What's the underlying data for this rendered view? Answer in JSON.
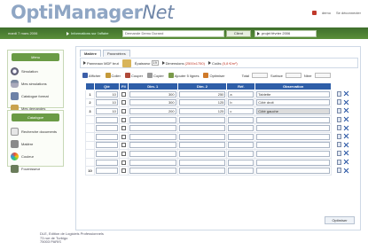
{
  "header": {
    "logo_main": "OptiManager",
    "logo_suffix": "Net",
    "user_name": "demo",
    "logout_label": "Se déconnecter"
  },
  "navbar": {
    "date": "mardi 7 mars 2006",
    "info_link": "Informations sur l'affaire",
    "request_value": "Demande Demo Durand",
    "client_button": "Client",
    "project": "projet février 2006"
  },
  "sidebar": {
    "menu_title": "Menu",
    "menu_items": [
      {
        "label": "Simulation",
        "icon": "clock-icon"
      },
      {
        "label": "Mes simulations",
        "icon": "person-icon"
      },
      {
        "label": "Catalogue format",
        "icon": "catalog-icon"
      },
      {
        "label": "Mes demandes",
        "icon": "folder-icon"
      }
    ],
    "catalog_title": "Catalogue",
    "catalog_items": [
      {
        "label": "Recherche documents",
        "icon": "search-icon"
      },
      {
        "label": "Matière",
        "icon": "material-icon"
      },
      {
        "label": "Couleur",
        "icon": "color-icon"
      },
      {
        "label": "Fournisseur",
        "icon": "supplier-icon"
      }
    ]
  },
  "footer": {
    "line1": "DLE, Edition de Logiciels Professionnels",
    "line2": "73 rue de Turbigo",
    "line3": "75003 PARIS"
  },
  "main": {
    "tabs": [
      "Matière",
      "Paramètres"
    ],
    "toolbar1": {
      "material_link": "Panneaux MDF brut",
      "thickness_label": "Épaisseur",
      "thickness_value": "19",
      "dimensions_link": "Dimensions",
      "dimensions_value": "(2500x1750)",
      "cuts_link": "Coûts",
      "cuts_value": "(5,8 €/m²)"
    },
    "toolbar2": {
      "add": "Afficher",
      "paste": "Coller",
      "delete": "Couper",
      "copy": "Copier",
      "add_lines": "Ajouter 5 lignes",
      "optimize": "Optimiser",
      "total_label": "Total",
      "surface_label": "Surface",
      "count_label": "Nbre"
    },
    "table": {
      "headers": [
        "",
        "Qté",
        "Fil",
        "Dim. 1",
        "Dim. 2",
        "Réf.",
        "Observation"
      ],
      "rows": [
        {
          "num": "1",
          "qty": "10",
          "dim1": "300",
          "dim2": "250",
          "ref": "a",
          "obs": "Tablette"
        },
        {
          "num": "2",
          "qty": "10",
          "dim1": "300",
          "dim2": "125",
          "ref": "b",
          "obs": "Côté droit"
        },
        {
          "num": "3",
          "qty": "10",
          "dim1": "200",
          "dim2": "125",
          "ref": "c",
          "obs": "Côté gauche"
        },
        {
          "num": "",
          "qty": "",
          "dim1": "",
          "dim2": "",
          "ref": "",
          "obs": ""
        },
        {
          "num": "",
          "qty": "",
          "dim1": "",
          "dim2": "",
          "ref": "",
          "obs": ""
        },
        {
          "num": "",
          "qty": "",
          "dim1": "",
          "dim2": "",
          "ref": "",
          "obs": ""
        },
        {
          "num": "",
          "qty": "",
          "dim1": "",
          "dim2": "",
          "ref": "",
          "obs": ""
        },
        {
          "num": "",
          "qty": "",
          "dim1": "",
          "dim2": "",
          "ref": "",
          "obs": ""
        },
        {
          "num": "",
          "qty": "",
          "dim1": "",
          "dim2": "",
          "ref": "",
          "obs": ""
        },
        {
          "num": "10",
          "qty": "",
          "dim1": "",
          "dim2": "",
          "ref": "",
          "obs": ""
        }
      ]
    },
    "optimize_button": "Optimiser"
  }
}
